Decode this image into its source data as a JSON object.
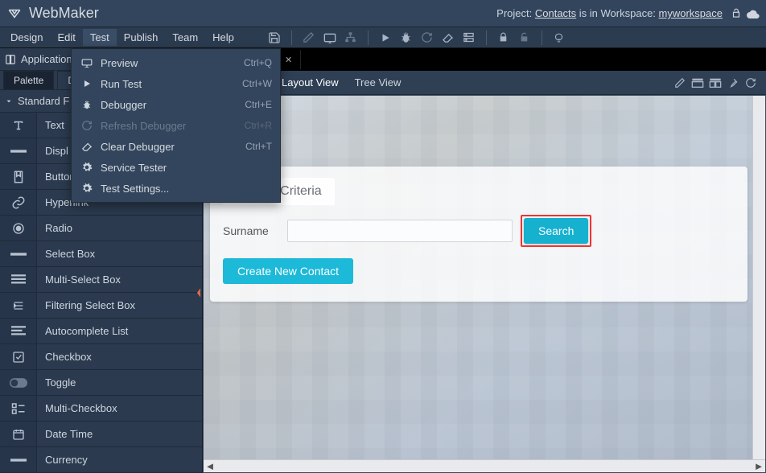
{
  "app": {
    "name": "WebMaker"
  },
  "project_bar": {
    "prefix": "Project: ",
    "project": "Contacts",
    "mid": " is in Workspace: ",
    "workspace": "myworkspace"
  },
  "menus": [
    "Design",
    "Edit",
    "Test",
    "Publish",
    "Team",
    "Help"
  ],
  "active_menu_index": 2,
  "test_menu": [
    {
      "icon": "monitor",
      "label": "Preview",
      "shortcut": "Ctrl+Q",
      "disabled": false
    },
    {
      "icon": "play",
      "label": "Run Test",
      "shortcut": "Ctrl+W",
      "disabled": false
    },
    {
      "icon": "bug",
      "label": "Debugger",
      "shortcut": "Ctrl+E",
      "disabled": false
    },
    {
      "icon": "refresh",
      "label": "Refresh Debugger",
      "shortcut": "Ctrl+R",
      "disabled": true
    },
    {
      "icon": "eraser",
      "label": "Clear Debugger",
      "shortcut": "Ctrl+T",
      "disabled": false
    },
    {
      "icon": "gear",
      "label": "Service Tester",
      "shortcut": "",
      "disabled": false
    },
    {
      "icon": "gear",
      "label": "Test Settings...",
      "shortcut": "",
      "disabled": false
    }
  ],
  "outline_tab": "Application",
  "palette_tabs": {
    "active": "Palette",
    "other": "D"
  },
  "palette_category": "Standard F",
  "palette_items": [
    {
      "icon": "text",
      "label": "Text"
    },
    {
      "icon": "display",
      "label": "Displ"
    },
    {
      "icon": "button",
      "label": "Button"
    },
    {
      "icon": "link",
      "label": "Hyperlink"
    },
    {
      "icon": "radio",
      "label": "Radio"
    },
    {
      "icon": "select",
      "label": "Select Box"
    },
    {
      "icon": "multiselect",
      "label": "Multi-Select Box"
    },
    {
      "icon": "filter",
      "label": "Filtering Select Box"
    },
    {
      "icon": "auto",
      "label": "Autocomplete List"
    },
    {
      "icon": "check",
      "label": "Checkbox"
    },
    {
      "icon": "toggle",
      "label": "Toggle"
    },
    {
      "icon": "multicheck",
      "label": "Multi-Checkbox"
    },
    {
      "icon": "datetime",
      "label": "Date Time"
    },
    {
      "icon": "currency",
      "label": "Currency"
    }
  ],
  "document_tab": {
    "close_glyph": "✕"
  },
  "views": [
    "Layout View",
    "Tree View"
  ],
  "form": {
    "section_title": "Search Criteria",
    "field_label": "Surname",
    "field_value": "",
    "search_button": "Search",
    "create_button": "Create New Contact"
  }
}
